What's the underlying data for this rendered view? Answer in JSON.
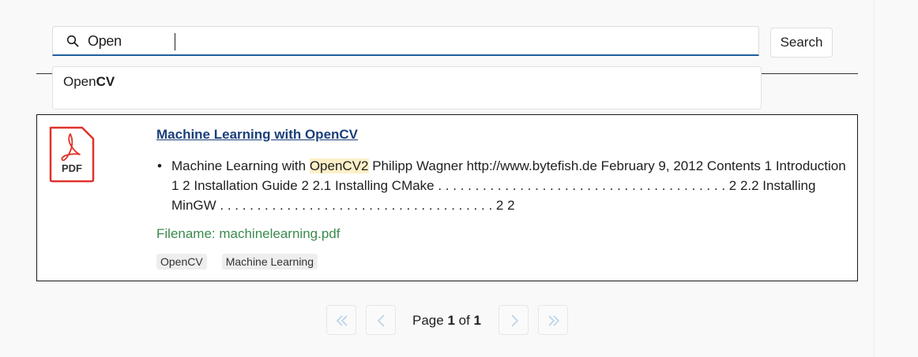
{
  "search": {
    "value": "Open",
    "button_label": "Search"
  },
  "suggestions": [
    {
      "prefix": "Open",
      "match": "CV"
    }
  ],
  "result": {
    "title": "Machine Learning with OpenCV",
    "icon_label": "PDF",
    "snippet": {
      "before": "Machine Learning with ",
      "highlight": "OpenCV2",
      "after": " Philipp Wagner http://www.bytefish.de February 9, 2012 Contents 1 Introduction 1 2 Installation Guide 2 2.1 Installing CMake . . . . . . . . . . . . . . . . . . . . . . . . . . . . . . . . . . . . . . . 2 2.2 Installing MinGW . . . . . . . . . . . . . . . . . . . . . . . . . . . . . . . . . . . . . 2 2"
    },
    "filename": "Filename: machinelearning.pdf",
    "tags": [
      "OpenCV",
      "Machine Learning"
    ]
  },
  "pagination": {
    "prefix": "Page ",
    "current": "1",
    "of": " of ",
    "total": "1"
  },
  "colors": {
    "accent": "#1f5f9e",
    "title_link": "#1b3f7a",
    "filename": "#3b8a4e",
    "highlight": "#fdf0c8",
    "pdf_red": "#e0322a"
  },
  "icons": {
    "search": "search-icon",
    "file": "pdf-file-icon",
    "first": "double-chevron-left-icon",
    "prev": "chevron-left-icon",
    "next": "chevron-right-icon",
    "last": "double-chevron-right-icon"
  }
}
